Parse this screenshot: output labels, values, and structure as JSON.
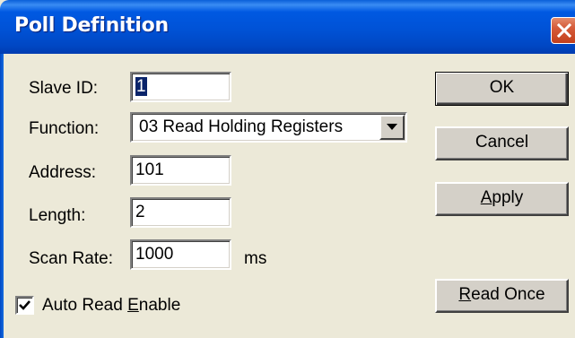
{
  "window": {
    "title": "Poll Definition",
    "close_icon": "close-icon"
  },
  "form": {
    "slave_id": {
      "label": "Slave ID:",
      "value": "1"
    },
    "function": {
      "label": "Function:",
      "value": "03 Read Holding Registers"
    },
    "address": {
      "label": "Address:",
      "value": "101"
    },
    "length": {
      "label": "Length:",
      "value": "2"
    },
    "scan_rate": {
      "label": "Scan Rate:",
      "value": "1000",
      "unit": "ms"
    },
    "auto_read": {
      "label_pre": "Auto Read ",
      "label_mnemonic": "E",
      "label_post": "nable",
      "checked": true
    }
  },
  "buttons": {
    "ok": "OK",
    "cancel": "Cancel",
    "apply": {
      "mnemonic": "A",
      "rest": "pply"
    },
    "read_once": {
      "mnemonic": "R",
      "rest": "ead Once"
    }
  },
  "colors": {
    "title_bar": "#0052d6",
    "dialog_bg": "#ece9d8",
    "close_button": "#d55b3a",
    "selection": "#0a246a"
  }
}
